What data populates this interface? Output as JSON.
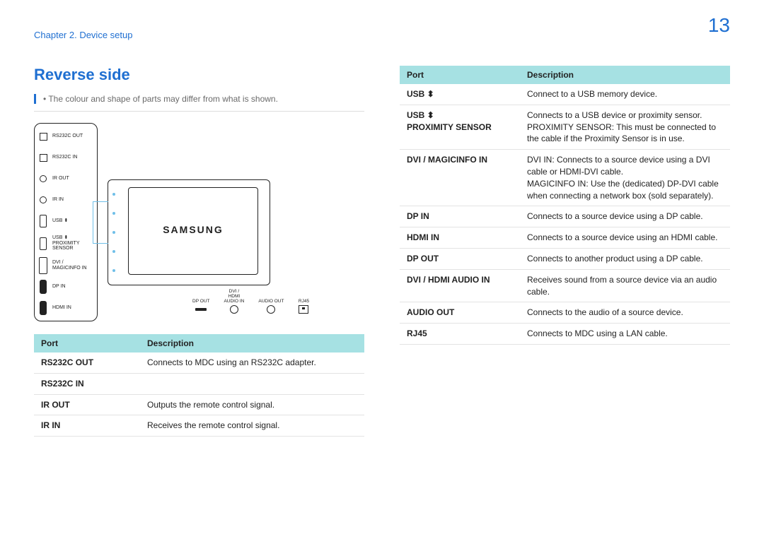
{
  "header": {
    "chapter": "Chapter 2. Device setup",
    "page_number": "13"
  },
  "section_title": "Reverse side",
  "note": "The colour and shape of parts may differ from what is shown.",
  "device_brand": "SAMSUNG",
  "side_ports": [
    {
      "icon": "sq",
      "label": "RS232C OUT"
    },
    {
      "icon": "sq",
      "label": "RS232C IN"
    },
    {
      "icon": "ci",
      "label": "IR OUT"
    },
    {
      "icon": "ci",
      "label": "IR IN"
    },
    {
      "icon": "usb",
      "label": "USB ⬍"
    },
    {
      "icon": "usb",
      "label": "USB ⬍\nPROXIMITY\nSENSOR"
    },
    {
      "icon": "dvi",
      "label": "DVI /\nMAGICINFO IN"
    },
    {
      "icon": "bar",
      "label": "DP IN"
    },
    {
      "icon": "bar",
      "label": "HDMI IN"
    }
  ],
  "bottom_ports": [
    {
      "icon": "slot",
      "label": "DP OUT"
    },
    {
      "icon": "ring",
      "label": "DVI /\nHDMI\nAUDIO IN"
    },
    {
      "icon": "ring",
      "label": "AUDIO OUT"
    },
    {
      "icon": "rj",
      "label": "RJ45"
    }
  ],
  "table_headers": {
    "port": "Port",
    "description": "Description"
  },
  "left_table": [
    {
      "port": "RS232C OUT",
      "desc": "Connects to MDC using an RS232C adapter."
    },
    {
      "port": "RS232C IN",
      "desc": ""
    },
    {
      "port": "IR OUT",
      "desc": "Outputs the remote control signal."
    },
    {
      "port": "IR IN",
      "desc": "Receives the remote control signal."
    }
  ],
  "right_table": [
    {
      "port": "USB ⬍",
      "desc": "Connect to a USB memory device."
    },
    {
      "port": "USB ⬍\nPROXIMITY SENSOR",
      "desc": "Connects to a USB device or proximity sensor.\nPROXIMITY SENSOR: This must be connected to the cable if the Proximity Sensor is in use."
    },
    {
      "port": "DVI / MAGICINFO IN",
      "desc": "DVI IN: Connects to a source device using a DVI cable or HDMI-DVI cable.\nMAGICINFO IN: Use the (dedicated) DP-DVI cable when connecting a network box (sold separately)."
    },
    {
      "port": "DP IN",
      "desc": "Connects to a source device using a DP cable."
    },
    {
      "port": "HDMI IN",
      "desc": "Connects to a source device using an HDMI cable."
    },
    {
      "port": "DP OUT",
      "desc": "Connects to another product using a DP cable."
    },
    {
      "port": "DVI / HDMI AUDIO IN",
      "desc": "Receives sound from a source device via an audio cable."
    },
    {
      "port": "AUDIO OUT",
      "desc": "Connects to the audio of a source device."
    },
    {
      "port": "RJ45",
      "desc": "Connects to MDC using a LAN cable."
    }
  ]
}
